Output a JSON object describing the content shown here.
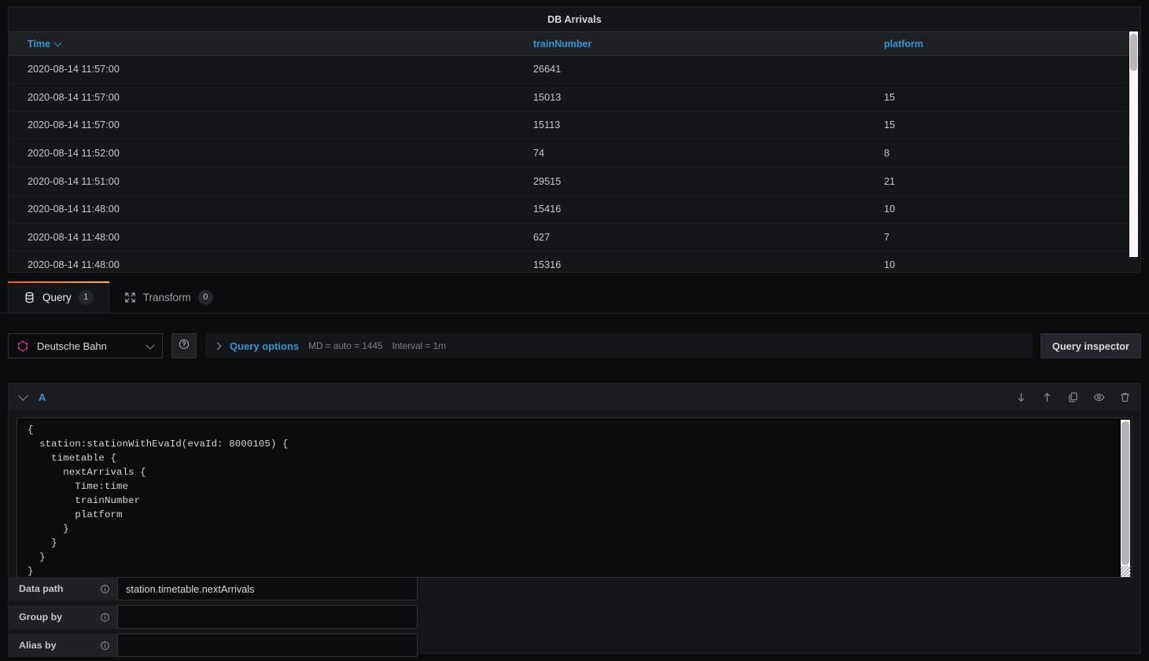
{
  "panel": {
    "title": "DB Arrivals",
    "table": {
      "columns": [
        "Time",
        "trainNumber",
        "platform"
      ],
      "sort_column": "Time",
      "sort_direction": "desc",
      "rows": [
        {
          "time": "2020-08-14 11:57:00",
          "trainNumber": "26641",
          "platform": ""
        },
        {
          "time": "2020-08-14 11:57:00",
          "trainNumber": "15013",
          "platform": "15"
        },
        {
          "time": "2020-08-14 11:57:00",
          "trainNumber": "15113",
          "platform": "15"
        },
        {
          "time": "2020-08-14 11:52:00",
          "trainNumber": "74",
          "platform": "8"
        },
        {
          "time": "2020-08-14 11:51:00",
          "trainNumber": "29515",
          "platform": "21"
        },
        {
          "time": "2020-08-14 11:48:00",
          "trainNumber": "15416",
          "platform": "10"
        },
        {
          "time": "2020-08-14 11:48:00",
          "trainNumber": "627",
          "platform": "7"
        },
        {
          "time": "2020-08-14 11:48:00",
          "trainNumber": "15316",
          "platform": "10"
        }
      ]
    }
  },
  "tabs": [
    {
      "label": "Query",
      "badge": "1",
      "icon": "database-icon",
      "active": true
    },
    {
      "label": "Transform",
      "badge": "0",
      "icon": "transform-icon",
      "active": false
    }
  ],
  "toolbar": {
    "datasource": "Deutsche Bahn",
    "datasource_icon": "graphql-logo-icon",
    "help_icon": "help-circle-icon",
    "query_options_label": "Query options",
    "max_data_points": "MD = auto = 1445",
    "interval": "Interval = 1m",
    "query_inspector_label": "Query inspector"
  },
  "query_row": {
    "name": "A",
    "actions": [
      {
        "name": "move-query-down-icon",
        "glyph": "arrow-down"
      },
      {
        "name": "move-query-up-icon",
        "glyph": "arrow-up"
      },
      {
        "name": "duplicate-query-icon",
        "glyph": "copy"
      },
      {
        "name": "toggle-query-visibility-icon",
        "glyph": "eye"
      },
      {
        "name": "remove-query-icon",
        "glyph": "trash"
      }
    ],
    "code": "{\n  station:stationWithEvaId(evaId: 8000105) {\n    timetable {\n      nextArrivals {\n        Time:time\n        trainNumber\n        platform\n      }\n    }\n  }\n}"
  },
  "fields": [
    {
      "label": "Data path",
      "value": "station.timetable.nextArrivals",
      "placeholder": ""
    },
    {
      "label": "Group by",
      "value": "",
      "placeholder": ""
    },
    {
      "label": "Alias by",
      "value": "",
      "placeholder": ""
    }
  ],
  "colors": {
    "accent_blue": "#3396d3",
    "tab_gradient_start": "#f05a28",
    "tab_gradient_end": "#fbbd2a",
    "graphql_pink": "#e535ab",
    "panel_bg": "#141619",
    "app_bg": "#0b0c0e"
  }
}
